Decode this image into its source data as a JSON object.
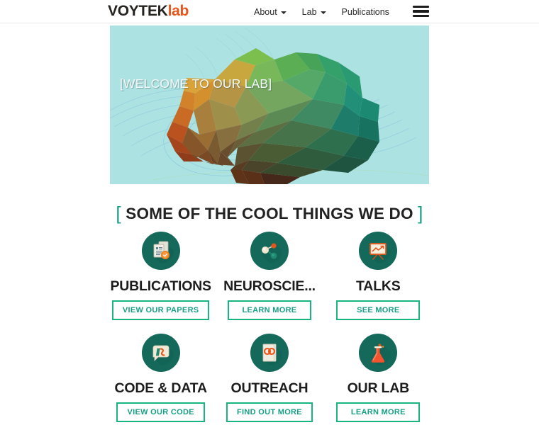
{
  "header": {
    "brand_main": "VOYTEK",
    "brand_accent": "lab",
    "nav": [
      {
        "label": "About",
        "has_caret": true
      },
      {
        "label": "Lab",
        "has_caret": true
      },
      {
        "label": "Publications",
        "has_caret": false
      }
    ],
    "menu_icon": "hamburger-menu-icon"
  },
  "hero": {
    "caption": "[WELCOME TO OUR LAB]",
    "background_color": "#ade2e2",
    "art": "low-poly-brain-with-contour-lines"
  },
  "section": {
    "bracket_open": "[",
    "bracket_close": "]",
    "heading": "SOME OF THE COOL THINGS WE DO",
    "bracket_color": "#16a085"
  },
  "colors": {
    "accent_orange": "#e8551b",
    "accent_teal": "#16a085",
    "button_border": "#17b57f",
    "icon_circle": "#14695a"
  },
  "cards": [
    {
      "icon": "documents-icon",
      "title": "PUBLICATIONS",
      "button": "VIEW OUR PAPERS"
    },
    {
      "icon": "neuron-network-icon",
      "title": "NEUROSCIE...",
      "button": "LEARN MORE"
    },
    {
      "icon": "presentation-chart-icon",
      "title": "TALKS",
      "button": "SEE MORE"
    },
    {
      "icon": "code-speech-bubble-icon",
      "title": "CODE & DATA",
      "button": "VIEW OUR CODE"
    },
    {
      "icon": "book-icon",
      "title": "OUTREACH",
      "button": "FIND OUT MORE"
    },
    {
      "icon": "flask-icon",
      "title": "OUR LAB",
      "button": "LEARN MORE"
    }
  ]
}
